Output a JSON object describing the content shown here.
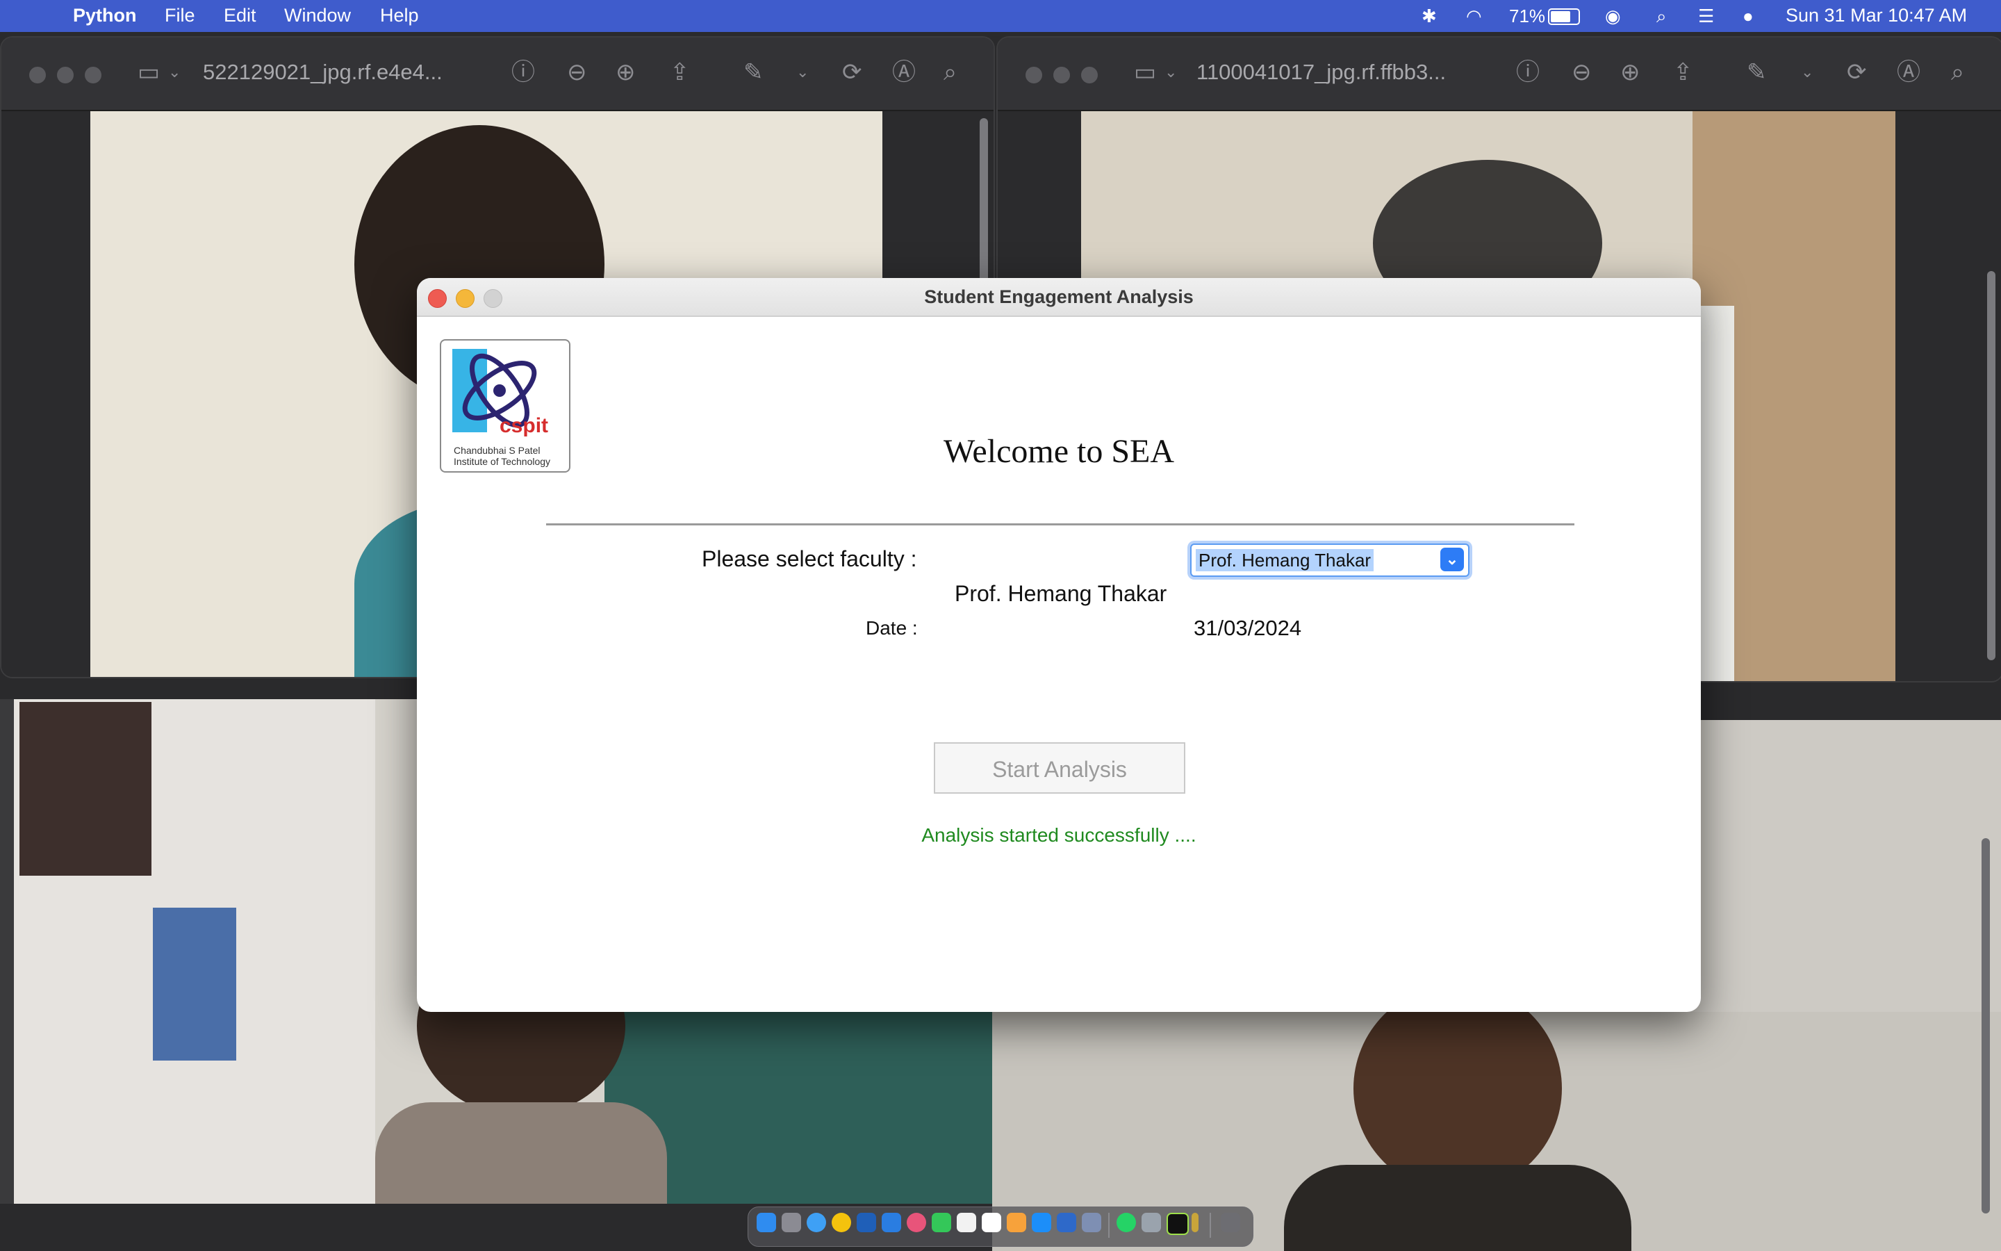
{
  "menubar": {
    "apple_icon": "apple-logo-icon",
    "app_name": "Python",
    "menus": [
      "File",
      "Edit",
      "Window",
      "Help"
    ],
    "battery_percent": "71%",
    "datetime": "Sun 31 Mar  10:47 AM"
  },
  "preview_windows": [
    {
      "title": "522129021_jpg.rf.e4e4..."
    },
    {
      "title": "1100041017_jpg.rf.ffbb3..."
    }
  ],
  "dialog": {
    "title": "Student Engagement Analysis",
    "logo": {
      "text": "cspit",
      "caption_line1": "Chandubhai S Patel",
      "caption_line2": "Institute of Technology"
    },
    "welcome": "Welcome to SEA",
    "faculty_label": "Please select faculty :",
    "faculty_selected": "Prof. Hemang Thakar",
    "faculty_display": "Prof. Hemang Thakar",
    "date_label": "Date :",
    "date_value": "31/03/2024",
    "start_button": "Start Analysis",
    "status": "Analysis started successfully ....",
    "status_color": "#1f8a1f"
  }
}
